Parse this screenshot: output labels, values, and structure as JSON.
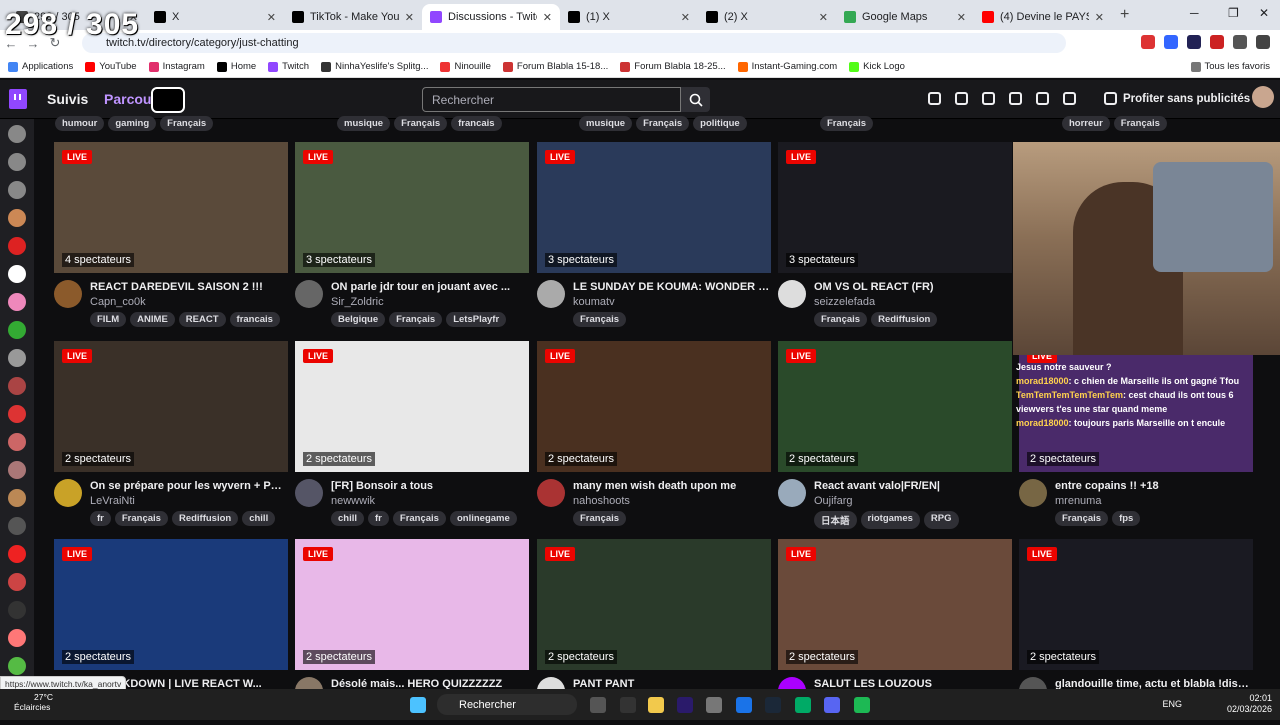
{
  "browser": {
    "tabs": [
      {
        "label": "298 / 305",
        "color": "#444"
      },
      {
        "label": "X",
        "color": "#000"
      },
      {
        "label": "TikTok - Make Your Day",
        "color": "#000"
      },
      {
        "label": "Discussions - Twitch",
        "color": "#9147ff"
      },
      {
        "label": "(1) X",
        "color": "#000"
      },
      {
        "label": "(2) X",
        "color": "#000"
      },
      {
        "label": "Google Maps",
        "color": "#34a853"
      },
      {
        "label": "(4) Devine le PAYS par son...",
        "color": "#ff0000"
      }
    ],
    "url": "twitch.tv/directory/category/just-chatting",
    "bookmarks": [
      "Applications",
      "YouTube",
      "Instagram",
      "Home",
      "Twitch",
      "NinhaYeslife's Splitg...",
      "Ninouille",
      "Forum Blabla 15-18...",
      "Forum Blabla 18-25...",
      "Instant-Gaming.com",
      "Kick Logo"
    ],
    "bookmarks_right": "Tous les favoris",
    "status_url": "https://www.twitch.tv/ka_anortv"
  },
  "twitch": {
    "nav_following": "Suivis",
    "nav_browse": "Parcourir",
    "search_placeholder": "Rechercher",
    "prime": "Profiter sans publicités"
  },
  "top_tags": [
    [
      "humour",
      "gaming",
      "Français"
    ],
    [
      "musique",
      "Français",
      "francais"
    ],
    [
      "musique",
      "Français",
      "politique"
    ],
    [
      "Français"
    ],
    [
      "horreur",
      "Français"
    ]
  ],
  "streams": [
    {
      "title": "REACT DAREDEVIL SAISON 2 !!!",
      "name": "Capn_co0k",
      "viewers": "4 spectateurs",
      "tags": [
        "FILM",
        "ANIME",
        "REACT",
        "francais"
      ],
      "thumb": "#5a4a3a",
      "av": "#8b5a2b"
    },
    {
      "title": "ON parle jdr tour en jouant avec ...",
      "name": "Sir_Zoldric",
      "viewers": "3 spectateurs",
      "tags": [
        "Belgique",
        "Français",
        "LetsPlayfr"
      ],
      "thumb": "#4a5a40",
      "av": "#666"
    },
    {
      "title": "LE SUNDAY DE KOUMA: WONDER MAN",
      "name": "koumatv",
      "viewers": "3 spectateurs",
      "tags": [
        "Français"
      ],
      "thumb": "#2a3a5a",
      "av": "#aaa"
    },
    {
      "title": "OM VS OL REACT (FR)",
      "name": "seizzelefada",
      "viewers": "3 spectateurs",
      "tags": [
        "Français",
        "Rediffusion"
      ],
      "thumb": "#1a1a20",
      "av": "#ddd"
    },
    {
      "title": "",
      "name": "",
      "viewers": "",
      "tags": [],
      "thumb": "#333",
      "av": "#333"
    },
    {
      "title": "On se prépare pour les wyvern + Popp...",
      "name": "LeVraiNti",
      "viewers": "2 spectateurs",
      "tags": [
        "fr",
        "Français",
        "Rediffusion",
        "chill"
      ],
      "thumb": "#3a3028",
      "av": "#c9a227"
    },
    {
      "title": "[FR] Bonsoir a tous",
      "name": "newwwik",
      "viewers": "2 spectateurs",
      "tags": [
        "chill",
        "fr",
        "Français",
        "onlinegame"
      ],
      "thumb": "#e8e8e8",
      "av": "#556"
    },
    {
      "title": "many men wish death upon me",
      "name": "nahoshoots",
      "viewers": "2 spectateurs",
      "tags": [
        "Français"
      ],
      "thumb": "#4a3020",
      "av": "#a33"
    },
    {
      "title": "React avant valo|FR/EN|",
      "name": "Oujifarg",
      "viewers": "2 spectateurs",
      "tags": [
        "日本語",
        "riotgames",
        "RPG"
      ],
      "thumb": "#2a4a2a",
      "av": "#9ab"
    },
    {
      "title": "entre copains !! +18",
      "name": "mrenuma",
      "viewers": "2 spectateurs",
      "tags": [
        "Français",
        "fps"
      ],
      "thumb": "#4a2a6a",
      "av": "#764"
    },
    {
      "title": "SMACKDOWN | LIVE REACT W...",
      "name": "",
      "viewers": "2 spectateurs",
      "tags": [],
      "thumb": "#1a3a7a",
      "av": "#999"
    },
    {
      "title": "Désolé mais... HERO QUIZZZZZZ",
      "name": "",
      "viewers": "2 spectateurs",
      "tags": [],
      "thumb": "#e8b8e8",
      "av": "#876"
    },
    {
      "title": "PANT PANT",
      "name": "",
      "viewers": "2 spectateurs",
      "tags": [],
      "thumb": "#2a3a2a",
      "av": "#ddd"
    },
    {
      "title": "SALUT LES LOUZOUS",
      "name": "",
      "viewers": "2 spectateurs",
      "tags": [],
      "thumb": "#6a4a3a",
      "av": "#a0f"
    },
    {
      "title": "glandouille time, actu et blabla !discor...",
      "name": "",
      "viewers": "2 spectateurs",
      "tags": [],
      "thumb": "#1a1a22",
      "av": "#555"
    }
  ],
  "overlay_counter": "298 / 305",
  "chat_overlay": [
    {
      "user": "",
      "text": "Jesus notre sauveur ?"
    },
    {
      "user": "morad18000",
      "text": ": c chien de Marseille ils ont gagné Tfou"
    },
    {
      "user": "TemTemTemTemTemTem",
      "text": ": cest chaud ils ont tous 6"
    },
    {
      "user": "",
      "text": "viewvers t'es une star quand meme"
    },
    {
      "user": "morad18000",
      "text": ": toujours paris Marseille on t encule"
    }
  ],
  "taskbar": {
    "search": "Rechercher",
    "weather_temp": "27°C",
    "weather_desc": "Éclaircies",
    "lang": "ENG",
    "time": "02:01",
    "date": "02/03/2026"
  },
  "live_label": "LIVE"
}
